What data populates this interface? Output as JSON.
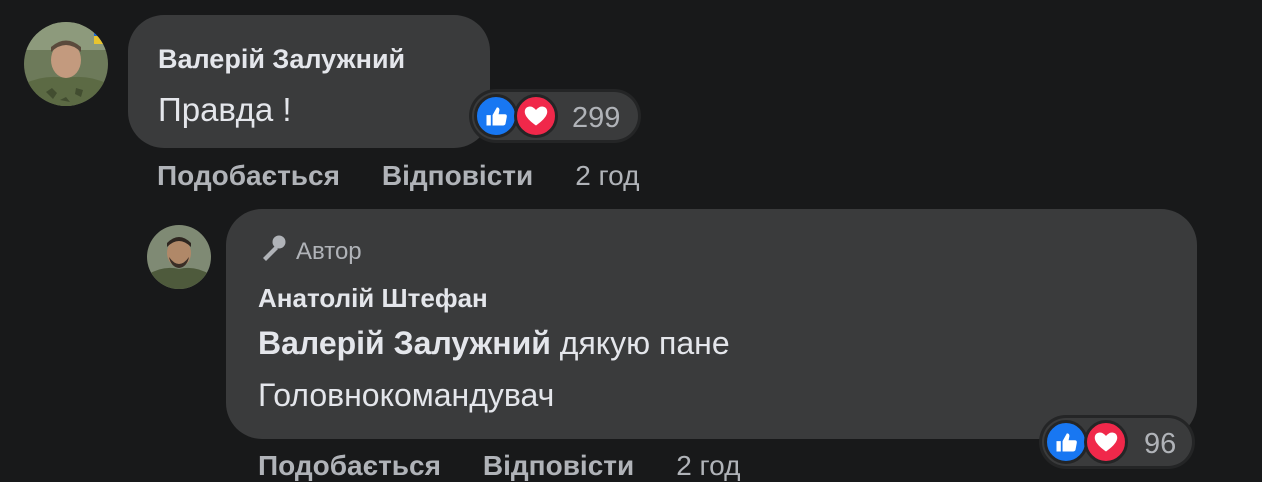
{
  "comment": {
    "author": "Валерій Залужний",
    "text": "Правда !",
    "reactions_count": "299",
    "actions": {
      "like": "Подобається",
      "reply": "Відповісти",
      "time": "2 год"
    }
  },
  "reply": {
    "badge": "Автор",
    "author": "Анатолій Штефан",
    "mention": "Валерій Залужний",
    "text_line1": " дякую пане",
    "text_line2": "Головнокомандувач",
    "reactions_count": "96",
    "actions": {
      "like": "Подобається",
      "reply": "Відповісти",
      "time": "2 год"
    }
  },
  "colors": {
    "background": "#18191a",
    "bubble": "#3a3b3c",
    "primary_text": "#e4e6eb",
    "secondary_text": "#b0b3b8",
    "like": "#1877f2",
    "love": "#f0284a"
  },
  "icons": {
    "like": "thumbs-up-icon",
    "love": "heart-icon",
    "author_badge": "microphone-icon"
  }
}
